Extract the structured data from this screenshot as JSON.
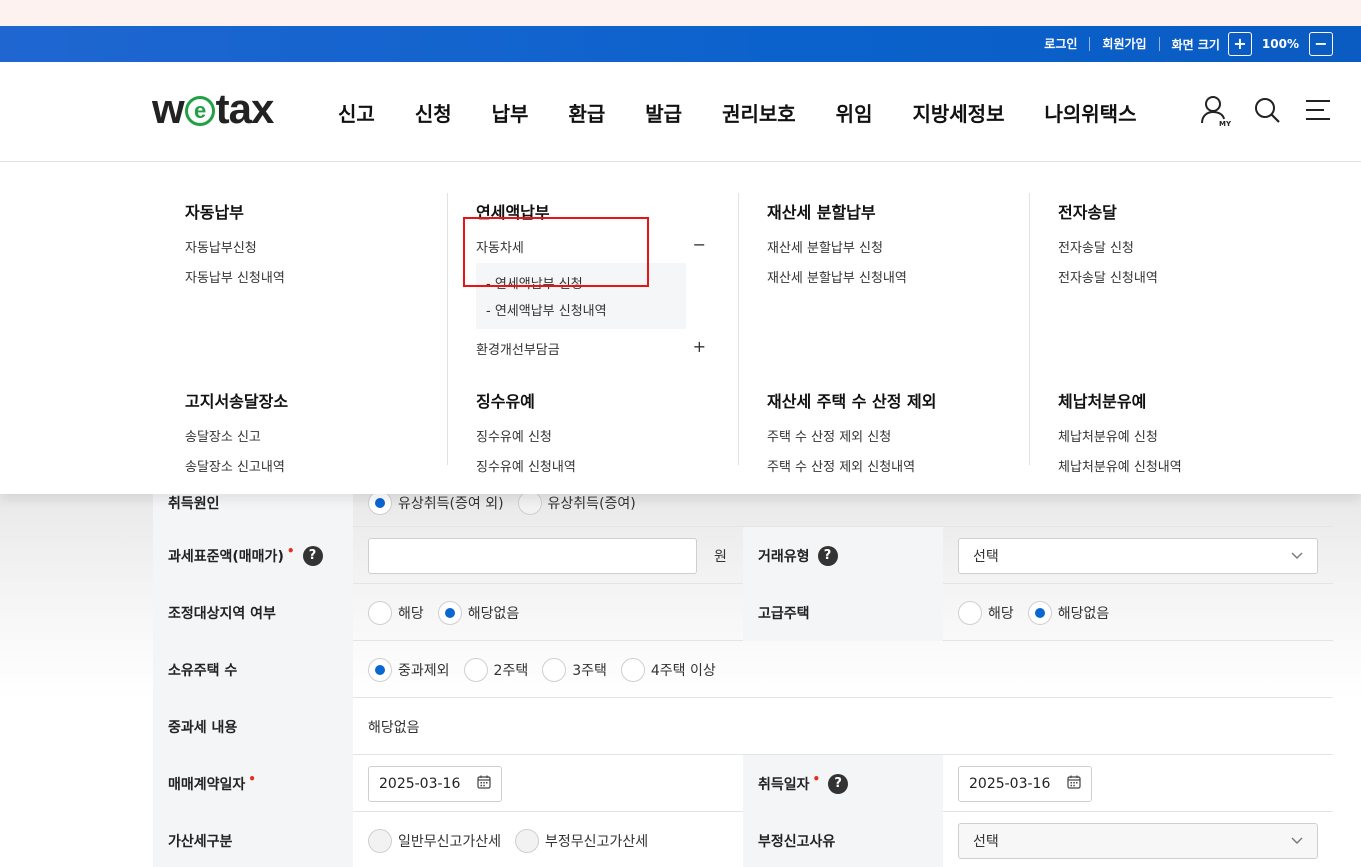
{
  "util": {
    "login": "로그인",
    "signup": "회원가입",
    "zoom_label": "화면 크기",
    "zoom_plus": "+",
    "zoom_value": "100%",
    "zoom_minus": "−"
  },
  "logo": {
    "pre": "w",
    "e": "e",
    "post": "tax"
  },
  "gnb": [
    "신고",
    "신청",
    "납부",
    "환급",
    "발급",
    "권리보호",
    "위임",
    "지방세정보",
    "나의위택스"
  ],
  "icons": {
    "my": "MY"
  },
  "mega": {
    "auto_pay": {
      "title": "자동납부",
      "links": [
        "자동납부신청",
        "자동납부 신청내역"
      ]
    },
    "annual": {
      "title": "연세액납부",
      "car_tax": "자동차세",
      "car_sign": "−",
      "subs": [
        "-  연세액납부 신청",
        "-  연세액납부 신청내역"
      ],
      "env": "환경개선부담금",
      "env_sign": "+"
    },
    "split": {
      "title": "재산세 분할납부",
      "links": [
        "재산세 분할납부 신청",
        "재산세 분할납부 신청내역"
      ]
    },
    "edelivery": {
      "title": "전자송달",
      "links": [
        "전자송달 신청",
        "전자송달 신청내역"
      ]
    },
    "notice_place": {
      "title": "고지서송달장소",
      "links": [
        "송달장소 신고",
        "송달장소 신고내역"
      ]
    },
    "defer": {
      "title": "징수유예",
      "links": [
        "징수유예 신청",
        "징수유예 신청내역"
      ]
    },
    "house_count": {
      "title": "재산세 주택 수 산정 제외",
      "links": [
        "주택 수 산정 제외 신청",
        "주택 수 산정 제외 신청내역"
      ]
    },
    "arrears": {
      "title": "체납처분유예",
      "links": [
        "체납처분유예 신청",
        "체납처분유예 신청내역"
      ]
    }
  },
  "form": {
    "acq_cause": {
      "label": "취득원인",
      "opt1": "유상취득(증여 외)",
      "opt2": "유상취득(증여)"
    },
    "tax_base": {
      "label": "과세표준액(매매가)",
      "unit": "원"
    },
    "deal_type": {
      "label": "거래유형",
      "value": "선택"
    },
    "adjust_area": {
      "label": "조정대상지역 여부",
      "opt1": "해당",
      "opt2": "해당없음"
    },
    "luxury": {
      "label": "고급주택",
      "opt1": "해당",
      "opt2": "해당없음"
    },
    "house_own": {
      "label": "소유주택 수",
      "opts": [
        "중과제외",
        "2주택",
        "3주택",
        "4주택 이상"
      ]
    },
    "heavy_tax": {
      "label": "중과세 내용",
      "value": "해당없음"
    },
    "contract_date": {
      "label": "매매계약일자",
      "value": "2025-03-16"
    },
    "acq_date": {
      "label": "취득일자",
      "value": "2025-03-16"
    },
    "penalty": {
      "label": "가산세구분",
      "opt1": "일반무신고가산세",
      "opt2": "부정무신고가산세"
    },
    "fraud_reason": {
      "label": "부정신고사유",
      "value": "선택"
    },
    "req_mark": "•",
    "help_mark": "?"
  },
  "colors": {
    "util_bar": "#0b62cc",
    "radio_on": "#0a66d1",
    "highlight": "#e81414",
    "logo_e": "#22a045"
  }
}
